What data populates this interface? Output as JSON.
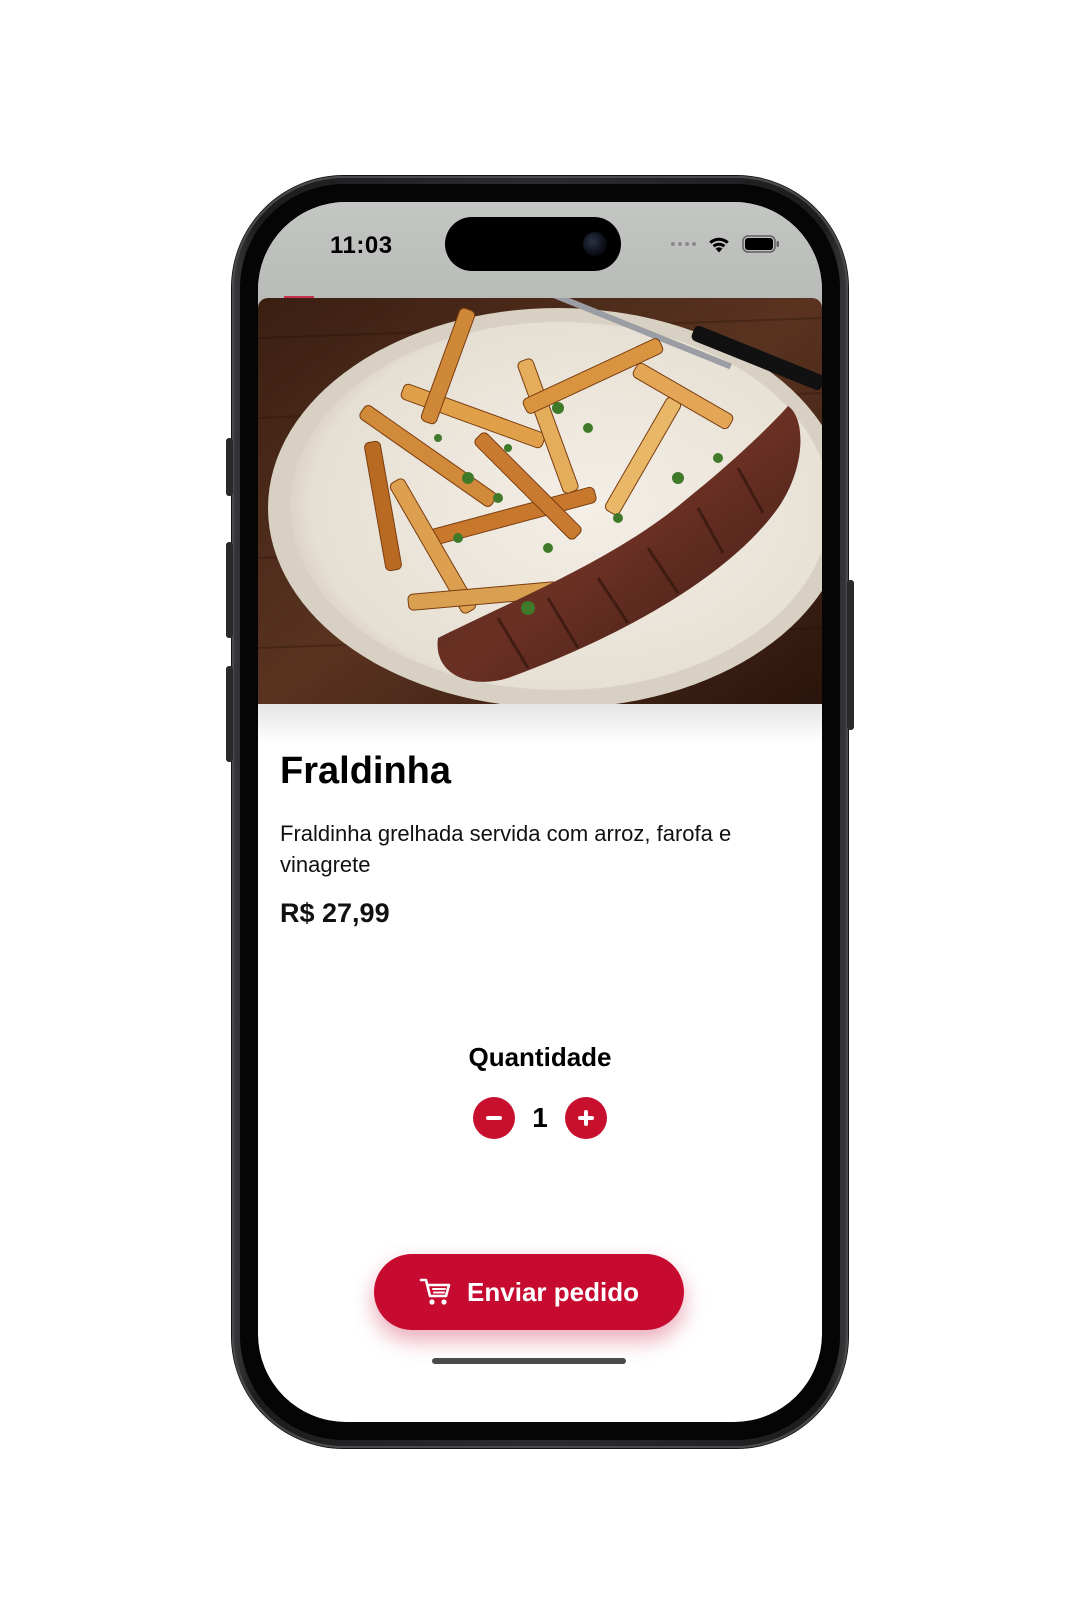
{
  "status_bar": {
    "time": "11:03",
    "icons": [
      "signal-dots-icon",
      "wifi-icon",
      "battery-icon"
    ]
  },
  "product": {
    "image": "grilled-flank-steak-with-fries-photo",
    "name": "Fraldinha",
    "description": "Fraldinha grelhada servida com arroz, farofa e vinagrete",
    "price": "R$ 27,99"
  },
  "quantity": {
    "label": "Quantidade",
    "value": "1",
    "decrement_icon": "minus-icon",
    "increment_icon": "plus-icon"
  },
  "actions": {
    "send_label": "Enviar pedido",
    "send_icon": "cart-icon"
  },
  "colors": {
    "accent": "#c70a30",
    "text": "#000000",
    "background": "#ffffff"
  }
}
